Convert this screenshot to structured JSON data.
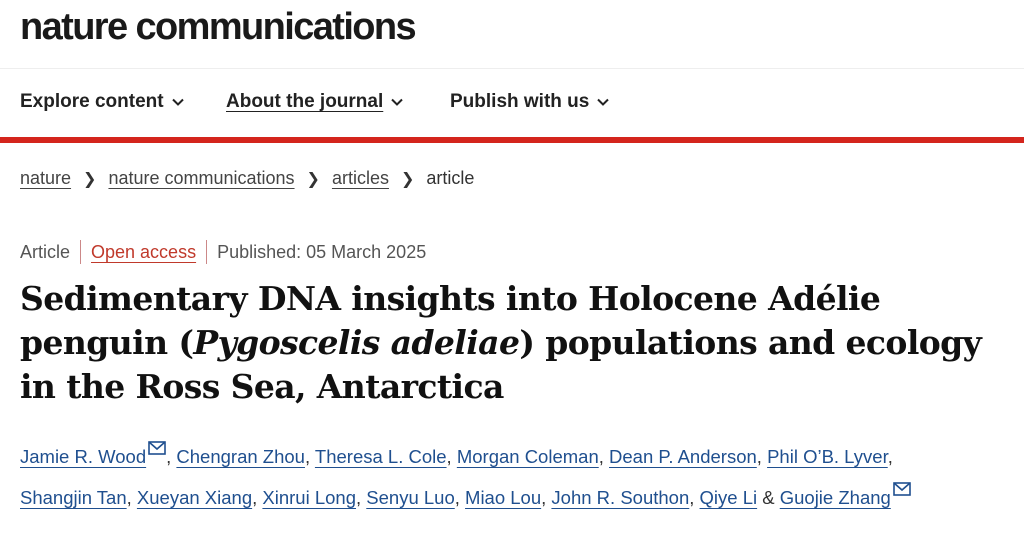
{
  "site": {
    "logo": "nature communications"
  },
  "nav": [
    {
      "label": "Explore content"
    },
    {
      "label": "About the journal"
    },
    {
      "label": "Publish with us"
    }
  ],
  "breadcrumb": [
    "nature",
    "nature communications",
    "articles",
    "article"
  ],
  "meta": {
    "type": "Article",
    "access": "Open access",
    "published": "Published: 05 March 2025"
  },
  "title": {
    "part1": "Sedimentary DNA insights into Holocene Adélie penguin (",
    "italic": "Pygoscelis adeliae",
    "part2": ") populations and ecology in the Ross Sea, Antarctica"
  },
  "authors": [
    "Jamie R. Wood",
    "Chengran Zhou",
    "Theresa L. Cole",
    "Morgan Coleman",
    "Dean P. Anderson",
    "Phil O’B. Lyver",
    "Shangjin Tan",
    "Xueyan Xiang",
    "Xinrui Long",
    "Senyu Luo",
    "Miao Lou",
    "John R. Southon",
    "Qiye Li",
    "Guojie Zhang"
  ],
  "authors_and": "&",
  "colors": {
    "accent_red": "#d4251d",
    "link_blue": "#1f4f8f",
    "open_access": "#c0392b"
  }
}
